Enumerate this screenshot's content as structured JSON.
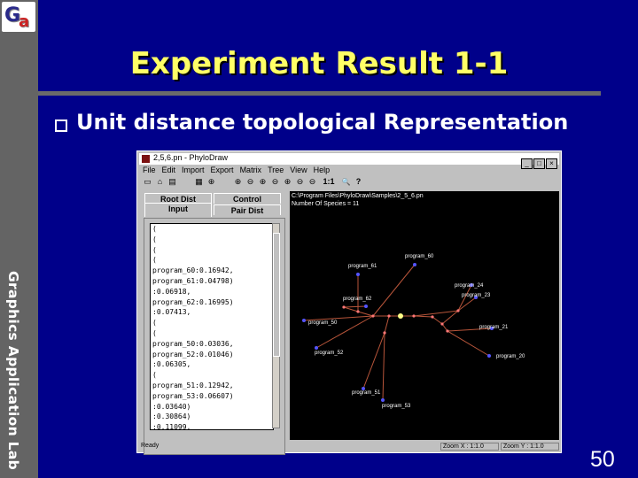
{
  "slide": {
    "title": "Experiment Result 1-1",
    "bullet": "Unit distance topological Representation",
    "side_label": "Graphics Application Lab",
    "page_number": "50",
    "logo_text": "Ga"
  },
  "window": {
    "title": "2,5,6.pn - PhyloDraw",
    "buttons": [
      "_",
      "□",
      "×"
    ],
    "menu": [
      "File",
      "Edit",
      "Import",
      "Export",
      "Matrix",
      "Tree",
      "View",
      "Help"
    ],
    "toolbar": [
      "▭",
      "⌂",
      "▤",
      "▦",
      "⊕",
      "⊕",
      "⊖",
      "⊕",
      "⊖",
      "⊕",
      "⊖",
      "⊖",
      "1:1",
      "🔍",
      "?"
    ],
    "tabs": {
      "root_dist": "Root Dist",
      "control": "Control",
      "input": "Input",
      "pair_dist": "Pair Dist"
    },
    "text_lines": [
      "(",
      "(",
      "(",
      "(",
      "program_60:0.16942,",
      "program_61:0.04798)",
      ":0.06918,",
      "program_62:0.16995)",
      ":0.07413,",
      "(",
      "(",
      "program_50:0.03036,",
      "program_52:0.01046)",
      ":0.06305,",
      "(",
      "program_51:0.12942,",
      "program_53:0.06607)",
      ":0.03640)",
      ":0.30864)",
      ":0.11099,"
    ],
    "canvas_header": [
      "C:\\Program Files\\PhyloDraw\\Samples\\2_5_6.pn",
      "Number Of Species = 11"
    ],
    "status": {
      "ready": "Ready",
      "zoom_x": "Zoom X : 1:1.0",
      "zoom_y": "Zoom Y : 1:1.0"
    }
  },
  "tree": {
    "leaf_labels": [
      "program_60",
      "program_61",
      "program_62",
      "program_24",
      "program_23",
      "program_21",
      "program_20",
      "program_50",
      "program_52",
      "program_51",
      "program_53"
    ],
    "colors": {
      "leaf": "#5555ff",
      "edge": "#b8553a",
      "node": "#ff7777",
      "root": "#ffff88",
      "label": "#ffffff"
    }
  }
}
